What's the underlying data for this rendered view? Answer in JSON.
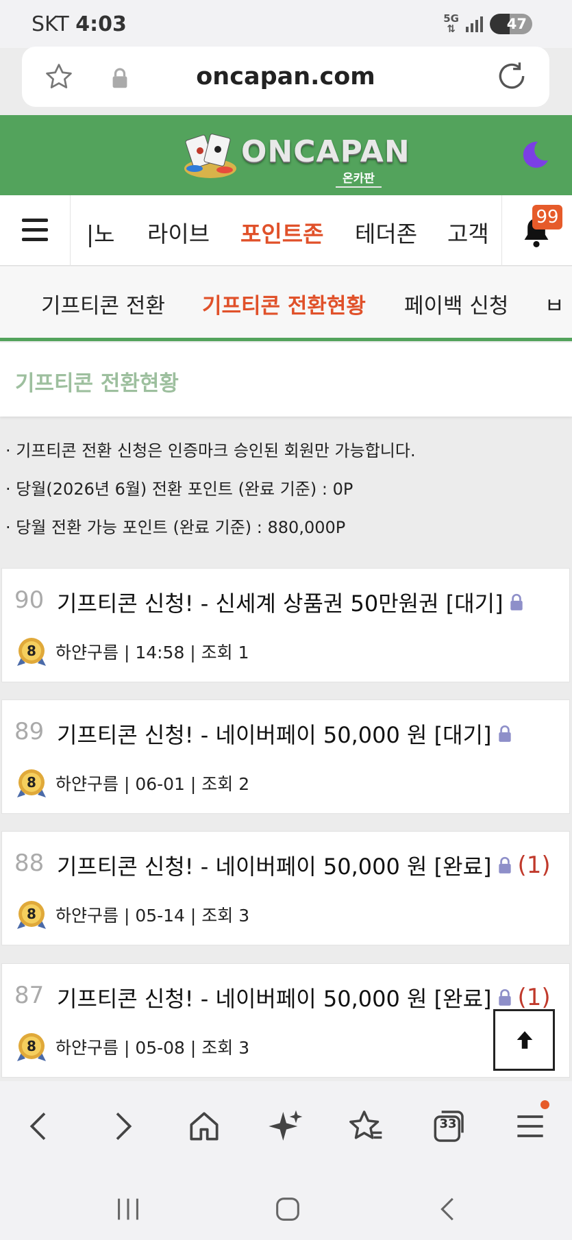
{
  "status_bar": {
    "carrier": "SKT",
    "time": "4:03",
    "network": "5G",
    "battery": "47",
    "battery_level": 0.47
  },
  "browser": {
    "url": "oncapan.com"
  },
  "site": {
    "logo_text": "ONCAPAN",
    "logo_sub": "온카판"
  },
  "main_nav": {
    "items": [
      {
        "label": "|노"
      },
      {
        "label": "라이브"
      },
      {
        "label": "포인트존",
        "active": true
      },
      {
        "label": "테더존"
      },
      {
        "label": "고객"
      }
    ],
    "notification_count": "99"
  },
  "sub_nav": {
    "items": [
      {
        "label": "기프티콘 전환"
      },
      {
        "label": "기프티콘 전환현황",
        "active": true
      },
      {
        "label": "페이백 신청"
      },
      {
        "label": "ㅂ"
      }
    ]
  },
  "page_title": "기프티콘 전환현황",
  "notices": [
    "· 기프티콘 전환 신청은 인증마크 승인된 회원만 가능합니다.",
    "· 당월(2026년 6월) 전환 포인트 (완료 기준) : 0P",
    "· 당월 전환 가능 포인트 (완료 기준) : 880,000P"
  ],
  "posts": [
    {
      "num": "90",
      "title": "기프티콘 신청! - 신세계 상품권 50만원권 [대기]",
      "comments": "",
      "level": "8",
      "meta": "하얀구름 | 14:58 | 조회 1"
    },
    {
      "num": "89",
      "title": "기프티콘 신청! - 네이버페이 50,000 원 [대기]",
      "comments": "",
      "level": "8",
      "meta": "하얀구름 | 06-01 | 조회 2"
    },
    {
      "num": "88",
      "title": "기프티콘 신청! - 네이버페이 50,000 원 [완료]",
      "comments": "(1)",
      "level": "8",
      "meta": "하얀구름 | 05-14 | 조회 3"
    },
    {
      "num": "87",
      "title": "기프티콘 신청! - 네이버페이 50,000 원 [완료]",
      "comments": "(1)",
      "level": "8",
      "meta": "하얀구름 | 05-08 | 조회 3"
    }
  ],
  "toolbar": {
    "tab_count": "33"
  },
  "colors": {
    "brand_green": "#53a35c",
    "accent_orange": "#e0512a",
    "title_green": "#9dbf9e",
    "lock_purple": "#8e8fc9",
    "comment_red": "#c0392b"
  }
}
